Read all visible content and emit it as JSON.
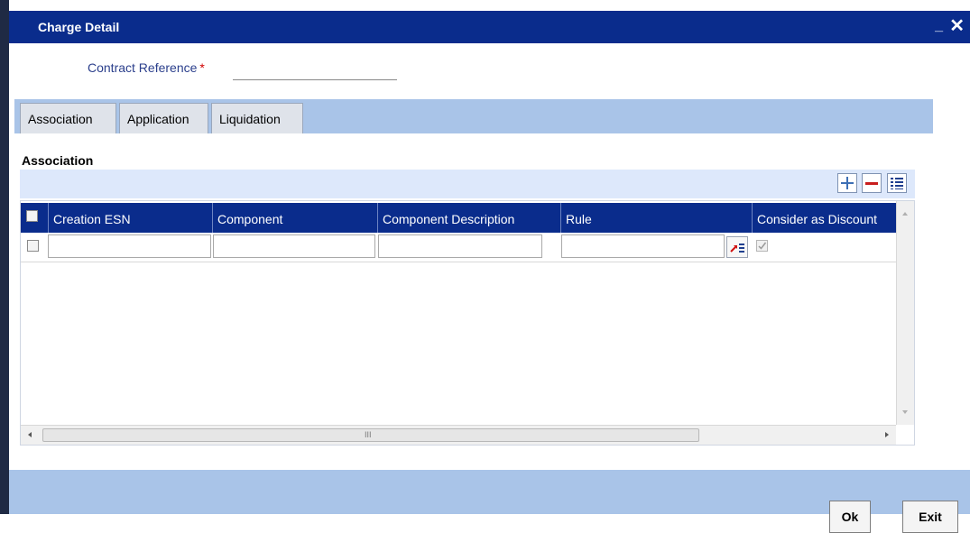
{
  "window": {
    "title": "Charge Detail",
    "minimize_glyph": "_",
    "close_glyph": "✕"
  },
  "contract": {
    "label": "Contract Reference",
    "required_mark": "*",
    "value": ""
  },
  "tabs": [
    {
      "label": "Association"
    },
    {
      "label": "Application"
    },
    {
      "label": "Liquidation"
    }
  ],
  "section": {
    "title": "Association"
  },
  "toolbar": {
    "add_icon": "plus-icon",
    "remove_icon": "minus-icon",
    "view_icon": "list-icon"
  },
  "table": {
    "columns": [
      "Creation ESN",
      "Component",
      "Component Description",
      "Rule",
      "Consider as Discount"
    ],
    "rows": [
      {
        "creation_esn": "",
        "component": "",
        "component_description": "",
        "rule": "",
        "consider_as_discount": true
      }
    ],
    "hscroll_grip": "III"
  },
  "buttons": {
    "ok": "Ok",
    "exit": "Exit"
  },
  "colors": {
    "title_bar": "#0a2c8c",
    "band": "#a9c4e8",
    "required": "#d00000"
  }
}
